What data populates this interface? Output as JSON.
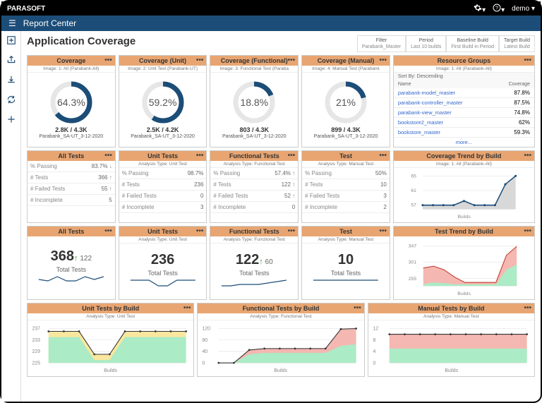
{
  "topbar": {
    "brand": "PARASOFT",
    "user": "demo"
  },
  "header": {
    "title": "Report Center"
  },
  "page": {
    "title": "Application Coverage"
  },
  "filters": [
    {
      "l1": "Filter",
      "l2": "Parabank_Master"
    },
    {
      "l1": "Period",
      "l2": "Last 10 builds"
    },
    {
      "l1": "Baseline Build",
      "l2": "First Build in Period"
    },
    {
      "l1": "Target Build",
      "l2": "Latest Build"
    }
  ],
  "coverage": [
    {
      "title": "Coverage",
      "sub": "Image: 1: All (Parabank-All)",
      "pct": "64.3%",
      "val": 64.3,
      "ratio": "2.8K / 4.3K",
      "build": "Parabank_SA-UT_3-12-2020"
    },
    {
      "title": "Coverage (Unit)",
      "sub": "Image: 2: Unit Test (Parabank-UT)",
      "pct": "59.2%",
      "val": 59.2,
      "ratio": "2.5K / 4.2K",
      "build": "Parabank_SA-UT_3-12-2020"
    },
    {
      "title": "Coverage (Functional)",
      "sub": "Image: 3: Functional Test (Paraba",
      "pct": "18.8%",
      "val": 18.8,
      "ratio": "803 / 4.3K",
      "build": "Parabank_SA-UT_3-12-2020"
    },
    {
      "title": "Coverage (Manual)",
      "sub": "Image: 4: Manual Test (Parabank",
      "pct": "21%",
      "val": 21,
      "ratio": "899 / 4.3K",
      "build": "Parabank_SA-UT_3-12-2020"
    }
  ],
  "resgroups": {
    "title": "Resource Groups",
    "sub": "Image: 1: All (Parabank-All)",
    "sort": "Sort By: Descending",
    "colName": "Name",
    "colCov": "Coverage",
    "rows": [
      {
        "name": "parabank-model_master",
        "cov": "87.8%"
      },
      {
        "name": "parabank-controller_master",
        "cov": "87.5%"
      },
      {
        "name": "parabank-view_master",
        "cov": "74.8%"
      },
      {
        "name": "bookstore2_master",
        "cov": "62%"
      },
      {
        "name": "bookstore_master",
        "cov": "59.3%"
      }
    ],
    "more": "more..."
  },
  "testpanels": [
    {
      "title": "All Tests",
      "sub": "",
      "rows": [
        {
          "k": "% Passing",
          "v": "83.7%",
          "a": "down"
        },
        {
          "k": "# Tests",
          "v": "366",
          "a": "up"
        },
        {
          "k": "# Failed Tests",
          "v": "55",
          "a": "up"
        },
        {
          "k": "# Incomplete",
          "v": "5",
          "a": ""
        }
      ]
    },
    {
      "title": "Unit Tests",
      "sub": "Analysis Type: Unit Test",
      "rows": [
        {
          "k": "% Passing",
          "v": "98.7%",
          "a": ""
        },
        {
          "k": "# Tests",
          "v": "236",
          "a": ""
        },
        {
          "k": "# Failed Tests",
          "v": "0",
          "a": ""
        },
        {
          "k": "# Incomplete",
          "v": "3",
          "a": ""
        }
      ]
    },
    {
      "title": "Functional Tests",
      "sub": "Analysis Type: Functional Test",
      "rows": [
        {
          "k": "% Passing",
          "v": "57.4%",
          "a": "up"
        },
        {
          "k": "# Tests",
          "v": "122",
          "a": "up"
        },
        {
          "k": "# Failed Tests",
          "v": "52",
          "a": "up"
        },
        {
          "k": "# Incomplete",
          "v": "0",
          "a": ""
        }
      ]
    },
    {
      "title": "Test",
      "sub": "Analysis Type: Manual Test",
      "rows": [
        {
          "k": "% Passing",
          "v": "50%",
          "a": ""
        },
        {
          "k": "# Tests",
          "v": "10",
          "a": ""
        },
        {
          "k": "# Failed Tests",
          "v": "3",
          "a": ""
        },
        {
          "k": "# Incomplete",
          "v": "2",
          "a": ""
        }
      ]
    }
  ],
  "covtrend": {
    "title": "Coverage Trend by Build",
    "sub": "Image: 1: All (Parabank-All)",
    "yticks": [
      "65",
      "61",
      "57"
    ],
    "xlabel": "Builds",
    "points": [
      58,
      58,
      58,
      58,
      59,
      58,
      58,
      58,
      63,
      65
    ]
  },
  "totals": [
    {
      "title": "All Tests",
      "sub": "",
      "num": "368",
      "delta": " 122",
      "arrow": "up",
      "label": "Total Tests",
      "spark": [
        10,
        8,
        14,
        8,
        8,
        14,
        10,
        14
      ]
    },
    {
      "title": "Unit Tests",
      "sub": "Analysis Type: Unit Test",
      "num": "236",
      "delta": "",
      "arrow": "",
      "label": "Total Tests",
      "spark": [
        14,
        14,
        14,
        6,
        6,
        14,
        14,
        14
      ]
    },
    {
      "title": "Functional Tests",
      "sub": "Analysis Type: Functional Test",
      "num": "122",
      "delta": " 60",
      "arrow": "up",
      "label": "Total Tests",
      "spark": [
        6,
        6,
        8,
        8,
        8,
        10,
        12,
        14
      ]
    },
    {
      "title": "Test",
      "sub": "Analysis Type: Manual Test",
      "num": "10",
      "delta": "",
      "arrow": "",
      "label": "Total Tests",
      "spark": [
        14,
        14,
        14,
        14,
        14,
        14,
        14,
        14
      ]
    }
  ],
  "testtrend": {
    "title": "Test Trend by Build",
    "sub": "",
    "yticks": [
      "347",
      "301",
      "255"
    ],
    "xlabel": "Builds",
    "red": [
      300,
      305,
      295,
      275,
      260,
      260,
      260,
      260,
      335,
      360
    ],
    "grn": [
      255,
      260,
      258,
      255,
      255,
      255,
      255,
      255,
      295,
      310
    ]
  },
  "bottom": [
    {
      "title": "Unit Tests by Build",
      "sub": "Analysis Type: Unit Test",
      "yticks": [
        "237",
        "233",
        "229",
        "225"
      ],
      "xlabel": "Builds",
      "yel": [
        236,
        236,
        236,
        228,
        228,
        236,
        236,
        236,
        236,
        236
      ],
      "grn": [
        234,
        234,
        234,
        226,
        226,
        234,
        234,
        234,
        234,
        234
      ]
    },
    {
      "title": "Functional Tests by Build",
      "sub": "Analysis Type: Functional Test",
      "yticks": [
        "120",
        "80",
        "40",
        "0"
      ],
      "xlabel": "Builds",
      "red": [
        0,
        0,
        45,
        50,
        50,
        50,
        50,
        50,
        118,
        120
      ],
      "grn": [
        0,
        0,
        30,
        35,
        35,
        35,
        35,
        35,
        60,
        65
      ]
    },
    {
      "title": "Manual Tests by Build",
      "sub": "Analysis Type: Manual Test",
      "yticks": [
        "12",
        "8",
        "4",
        "0"
      ],
      "xlabel": "Builds",
      "red": [
        10,
        10,
        10,
        10,
        10,
        10,
        10,
        10,
        10,
        10
      ],
      "grn": [
        5,
        5,
        5,
        5,
        5,
        5,
        5,
        5,
        5,
        5
      ]
    }
  ],
  "chart_data": [
    {
      "type": "line",
      "title": "Coverage Trend by Build",
      "xlabel": "Builds",
      "ylabel": "",
      "ylim": [
        57,
        65
      ],
      "series": [
        {
          "name": "coverage",
          "values": [
            58,
            58,
            58,
            58,
            59,
            58,
            58,
            58,
            63,
            65
          ]
        }
      ]
    },
    {
      "type": "area",
      "title": "Test Trend by Build",
      "xlabel": "Builds",
      "ylim": [
        255,
        360
      ],
      "series": [
        {
          "name": "fail",
          "values": [
            300,
            305,
            295,
            275,
            260,
            260,
            260,
            260,
            335,
            360
          ]
        },
        {
          "name": "pass",
          "values": [
            255,
            260,
            258,
            255,
            255,
            255,
            255,
            255,
            295,
            310
          ]
        }
      ]
    },
    {
      "type": "area",
      "title": "Unit Tests by Build",
      "xlabel": "Builds",
      "ylim": [
        225,
        237
      ],
      "series": [
        {
          "name": "total",
          "values": [
            236,
            236,
            236,
            228,
            228,
            236,
            236,
            236,
            236,
            236
          ]
        },
        {
          "name": "pass",
          "values": [
            234,
            234,
            234,
            226,
            226,
            234,
            234,
            234,
            234,
            234
          ]
        }
      ]
    },
    {
      "type": "area",
      "title": "Functional Tests by Build",
      "xlabel": "Builds",
      "ylim": [
        0,
        120
      ],
      "series": [
        {
          "name": "total",
          "values": [
            0,
            0,
            45,
            50,
            50,
            50,
            50,
            50,
            118,
            120
          ]
        },
        {
          "name": "pass",
          "values": [
            0,
            0,
            30,
            35,
            35,
            35,
            35,
            35,
            60,
            65
          ]
        }
      ]
    },
    {
      "type": "area",
      "title": "Manual Tests by Build",
      "xlabel": "Builds",
      "ylim": [
        0,
        12
      ],
      "series": [
        {
          "name": "total",
          "values": [
            10,
            10,
            10,
            10,
            10,
            10,
            10,
            10,
            10,
            10
          ]
        },
        {
          "name": "pass",
          "values": [
            5,
            5,
            5,
            5,
            5,
            5,
            5,
            5,
            5,
            5
          ]
        }
      ]
    }
  ]
}
